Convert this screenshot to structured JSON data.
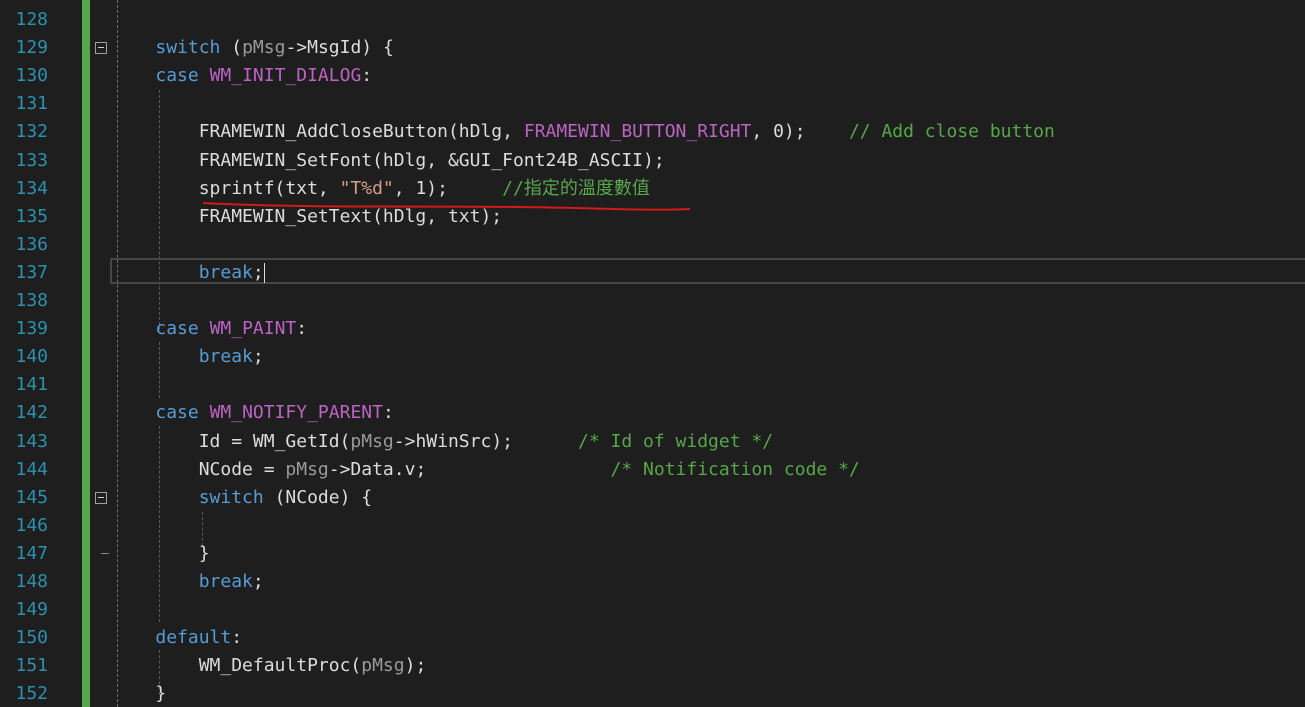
{
  "editor": {
    "colors": {
      "background": "#1e1e1e",
      "line_number": "#2b91af",
      "keyword": "#569cd6",
      "macro": "#bd63c5",
      "comment": "#57a64a",
      "string": "#d69d85",
      "change_bar": "#57a64a",
      "annotation": "#d11a1a"
    },
    "lines": [
      {
        "num": "128",
        "tokens": []
      },
      {
        "num": "129",
        "fold": "open",
        "tokens": [
          {
            "t": "    ",
            "c": "plain"
          },
          {
            "t": "switch",
            "c": "kw"
          },
          {
            "t": " (",
            "c": "plain"
          },
          {
            "t": "pMsg",
            "c": "var"
          },
          {
            "t": "->MsgId) {",
            "c": "plain"
          }
        ]
      },
      {
        "num": "130",
        "tokens": [
          {
            "t": "    ",
            "c": "plain"
          },
          {
            "t": "case",
            "c": "kw"
          },
          {
            "t": " ",
            "c": "plain"
          },
          {
            "t": "WM_INIT_DIALOG",
            "c": "mac"
          },
          {
            "t": ":",
            "c": "plain"
          }
        ]
      },
      {
        "num": "131",
        "tokens": []
      },
      {
        "num": "132",
        "tokens": [
          {
            "t": "        FRAMEWIN_AddCloseButton(hDlg, ",
            "c": "plain"
          },
          {
            "t": "FRAMEWIN_BUTTON_RIGHT",
            "c": "mac"
          },
          {
            "t": ", 0);    ",
            "c": "plain"
          },
          {
            "t": "// Add close button",
            "c": "cm"
          }
        ]
      },
      {
        "num": "133",
        "tokens": [
          {
            "t": "        FRAMEWIN_SetFont(hDlg, &GUI_Font24B_ASCII);",
            "c": "plain"
          }
        ]
      },
      {
        "num": "134",
        "tokens": [
          {
            "t": "        sprintf(txt, ",
            "c": "plain"
          },
          {
            "t": "\"T%d\"",
            "c": "str"
          },
          {
            "t": ", 1);     ",
            "c": "plain"
          },
          {
            "t": "//指定的溫度數值",
            "c": "cm"
          }
        ]
      },
      {
        "num": "135",
        "tokens": [
          {
            "t": "        FRAMEWIN_SetText(hDlg, txt);",
            "c": "plain"
          }
        ]
      },
      {
        "num": "136",
        "tokens": []
      },
      {
        "num": "137",
        "current": true,
        "tokens": [
          {
            "t": "        ",
            "c": "plain"
          },
          {
            "t": "break",
            "c": "kw"
          },
          {
            "t": ";",
            "c": "plain"
          }
        ]
      },
      {
        "num": "138",
        "tokens": []
      },
      {
        "num": "139",
        "tokens": [
          {
            "t": "    ",
            "c": "plain"
          },
          {
            "t": "case",
            "c": "kw"
          },
          {
            "t": " ",
            "c": "plain"
          },
          {
            "t": "WM_PAINT",
            "c": "mac"
          },
          {
            "t": ":",
            "c": "plain"
          }
        ]
      },
      {
        "num": "140",
        "tokens": [
          {
            "t": "        ",
            "c": "plain"
          },
          {
            "t": "break",
            "c": "kw"
          },
          {
            "t": ";",
            "c": "plain"
          }
        ]
      },
      {
        "num": "141",
        "tokens": []
      },
      {
        "num": "142",
        "tokens": [
          {
            "t": "    ",
            "c": "plain"
          },
          {
            "t": "case",
            "c": "kw"
          },
          {
            "t": " ",
            "c": "plain"
          },
          {
            "t": "WM_NOTIFY_PARENT",
            "c": "mac"
          },
          {
            "t": ":",
            "c": "plain"
          }
        ]
      },
      {
        "num": "143",
        "tokens": [
          {
            "t": "        Id = WM_GetId(",
            "c": "plain"
          },
          {
            "t": "pMsg",
            "c": "var"
          },
          {
            "t": "->hWinSrc);      ",
            "c": "plain"
          },
          {
            "t": "/* Id of widget */",
            "c": "cm"
          }
        ]
      },
      {
        "num": "144",
        "tokens": [
          {
            "t": "        NCode = ",
            "c": "plain"
          },
          {
            "t": "pMsg",
            "c": "var"
          },
          {
            "t": "->Data.v;                 ",
            "c": "plain"
          },
          {
            "t": "/* Notification code */",
            "c": "cm"
          }
        ]
      },
      {
        "num": "145",
        "fold": "open",
        "tokens": [
          {
            "t": "        ",
            "c": "plain"
          },
          {
            "t": "switch",
            "c": "kw"
          },
          {
            "t": " (NCode) {",
            "c": "plain"
          }
        ]
      },
      {
        "num": "146",
        "tokens": []
      },
      {
        "num": "147",
        "fold": "end",
        "tokens": [
          {
            "t": "        }",
            "c": "plain"
          }
        ]
      },
      {
        "num": "148",
        "tokens": [
          {
            "t": "        ",
            "c": "plain"
          },
          {
            "t": "break",
            "c": "kw"
          },
          {
            "t": ";",
            "c": "plain"
          }
        ]
      },
      {
        "num": "149",
        "tokens": []
      },
      {
        "num": "150",
        "tokens": [
          {
            "t": "    ",
            "c": "plain"
          },
          {
            "t": "default",
            "c": "kw"
          },
          {
            "t": ":",
            "c": "plain"
          }
        ]
      },
      {
        "num": "151",
        "tokens": [
          {
            "t": "        WM_DefaultProc(",
            "c": "plain"
          },
          {
            "t": "pMsg",
            "c": "var"
          },
          {
            "t": ");",
            "c": "plain"
          }
        ]
      },
      {
        "num": "152",
        "tokens": [
          {
            "t": "    }",
            "c": "plain"
          }
        ]
      }
    ]
  }
}
